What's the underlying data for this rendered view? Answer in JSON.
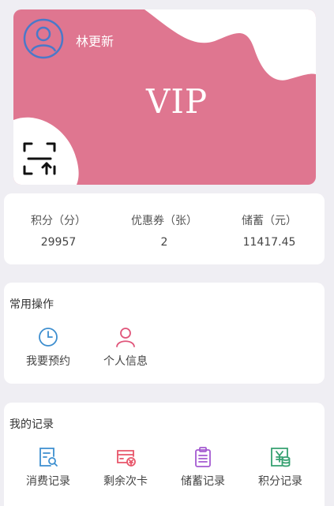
{
  "user": {
    "name": "林更新",
    "vip_badge": "VIP",
    "avatar_icon": "user-icon",
    "scan_icon": "scan-upload-icon"
  },
  "stats": [
    {
      "label": "积分（分）",
      "value": "29957"
    },
    {
      "label": "优惠券（张）",
      "value": "2"
    },
    {
      "label": "储蓄（元）",
      "value": "11417.45"
    }
  ],
  "common_ops": {
    "title": "常用操作",
    "items": [
      {
        "label": "我要预约",
        "icon": "clock-icon",
        "color": "#3d8ecf"
      },
      {
        "label": "个人信息",
        "icon": "person-icon",
        "color": "#e0557a"
      }
    ]
  },
  "my_records": {
    "title": "我的记录",
    "items": [
      {
        "label": "消费记录",
        "icon": "receipt-search-icon",
        "color": "#3c8fd0"
      },
      {
        "label": "剩余次卡",
        "icon": "card-coin-icon",
        "color": "#e8566a"
      },
      {
        "label": "储蓄记录",
        "icon": "clipboard-icon",
        "color": "#a45ad1"
      },
      {
        "label": "积分记录",
        "icon": "yen-coins-icon",
        "color": "#35a070"
      }
    ]
  },
  "colors": {
    "card": "#df7690",
    "background": "#efeef3",
    "panel": "#ffffff"
  }
}
